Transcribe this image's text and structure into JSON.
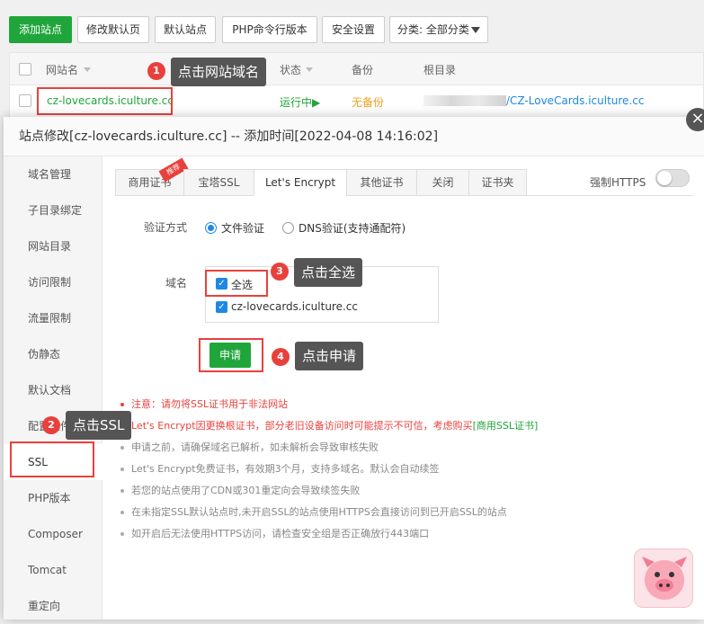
{
  "toolbar": {
    "add_site": "添加站点",
    "edit_default_page": "修改默认页",
    "default_site": "默认站点",
    "php_cli": "PHP命令行版本",
    "security": "安全设置",
    "category": "分类: 全部分类"
  },
  "table": {
    "col_site": "网站名",
    "col_status": "状态",
    "col_backup": "备份",
    "col_root": "根目录",
    "row": {
      "site": "cz-lovecards.iculture.cc",
      "status": "运行中▶",
      "backup": "无备份",
      "root": "/CZ-LoveCards.iculture.cc"
    }
  },
  "modal": {
    "title": "站点修改[cz-lovecards.iculture.cc] -- 添加时间[2022-04-08 14:16:02]",
    "close": "×",
    "sidebar": [
      {
        "label": "域名管理"
      },
      {
        "label": "子目录绑定"
      },
      {
        "label": "网站目录"
      },
      {
        "label": "访问限制"
      },
      {
        "label": "流量限制"
      },
      {
        "label": "伪静态"
      },
      {
        "label": "默认文档"
      },
      {
        "label": "配置文件"
      },
      {
        "label": "SSL"
      },
      {
        "label": "PHP版本"
      },
      {
        "label": "Composer"
      },
      {
        "label": "Tomcat"
      },
      {
        "label": "重定向"
      }
    ],
    "tabs": [
      {
        "label": "商用证书"
      },
      {
        "label": "宝塔SSL"
      },
      {
        "label": "Let's Encrypt"
      },
      {
        "label": "其他证书"
      },
      {
        "label": "关闭"
      },
      {
        "label": "证书夹"
      }
    ],
    "recommend_badge": "推荐",
    "force_https": "强制HTTPS",
    "verify_label": "验证方式",
    "verify_file": "文件验证",
    "verify_dns": "DNS验证(支持通配符)",
    "domain_label": "域名",
    "select_all": "全选",
    "domain_item": "cz-lovecards.iculture.cc",
    "apply_button": "申请",
    "notes": {
      "n1": "注意：请勿将SSL证书用于非法网站",
      "n2a": "Let's Encrypt因更换根证书，部分老旧设备访问时可能提示不可信，考虑购买",
      "n2b": "[商用SSL证书]",
      "n3": "申请之前，请确保域名已解析，如未解析会导致审核失败",
      "n4": "Let's Encrypt免费证书，有效期3个月，支持多域名。默认会自动续签",
      "n5": "若您的站点使用了CDN或301重定向会导致续签失败",
      "n6": "在未指定SSL默认站点时,未开启SSL的站点使用HTTPS会直接访问到已开启SSL的站点",
      "n7": "如开启后无法使用HTTPS访问，请检查安全组是否正确放行443端口"
    }
  },
  "callouts": {
    "c1_num": "1",
    "c1_text": "点击网站域名",
    "c2_num": "2",
    "c2_text": "点击SSL",
    "c3_num": "3",
    "c3_text": "点击全选",
    "c4_num": "4",
    "c4_text": "点击申请"
  },
  "colors": {
    "accent": "#20a53a",
    "annotation": "#e8413d",
    "link": "#1e88e5"
  },
  "icons": {
    "dropdown": "triangle-down",
    "pig": "pig-face",
    "close": "close-circle"
  }
}
